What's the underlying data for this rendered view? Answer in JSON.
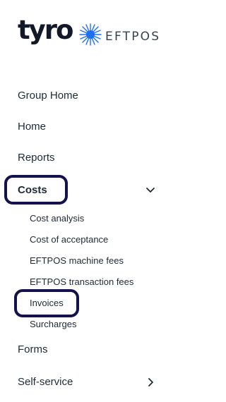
{
  "brand": {
    "logo_text": "tyro",
    "product": "EFTPOS",
    "burst_color": "#1f6ff2"
  },
  "nav": {
    "items": [
      {
        "label": "Group Home"
      },
      {
        "label": "Home"
      },
      {
        "label": "Reports"
      },
      {
        "label": "Costs",
        "expanded": true
      },
      {
        "label": "Forms"
      },
      {
        "label": "Self-service",
        "has_children": true
      }
    ],
    "costs_subitems": [
      {
        "label": "Cost analysis"
      },
      {
        "label": "Cost of acceptance"
      },
      {
        "label": "EFTPOS machine fees"
      },
      {
        "label": "EFTPOS transaction fees"
      },
      {
        "label": "Invoices",
        "highlighted": true
      },
      {
        "label": "Surcharges"
      }
    ]
  },
  "colors": {
    "highlight_border": "#13124d",
    "text": "#1f2937"
  }
}
